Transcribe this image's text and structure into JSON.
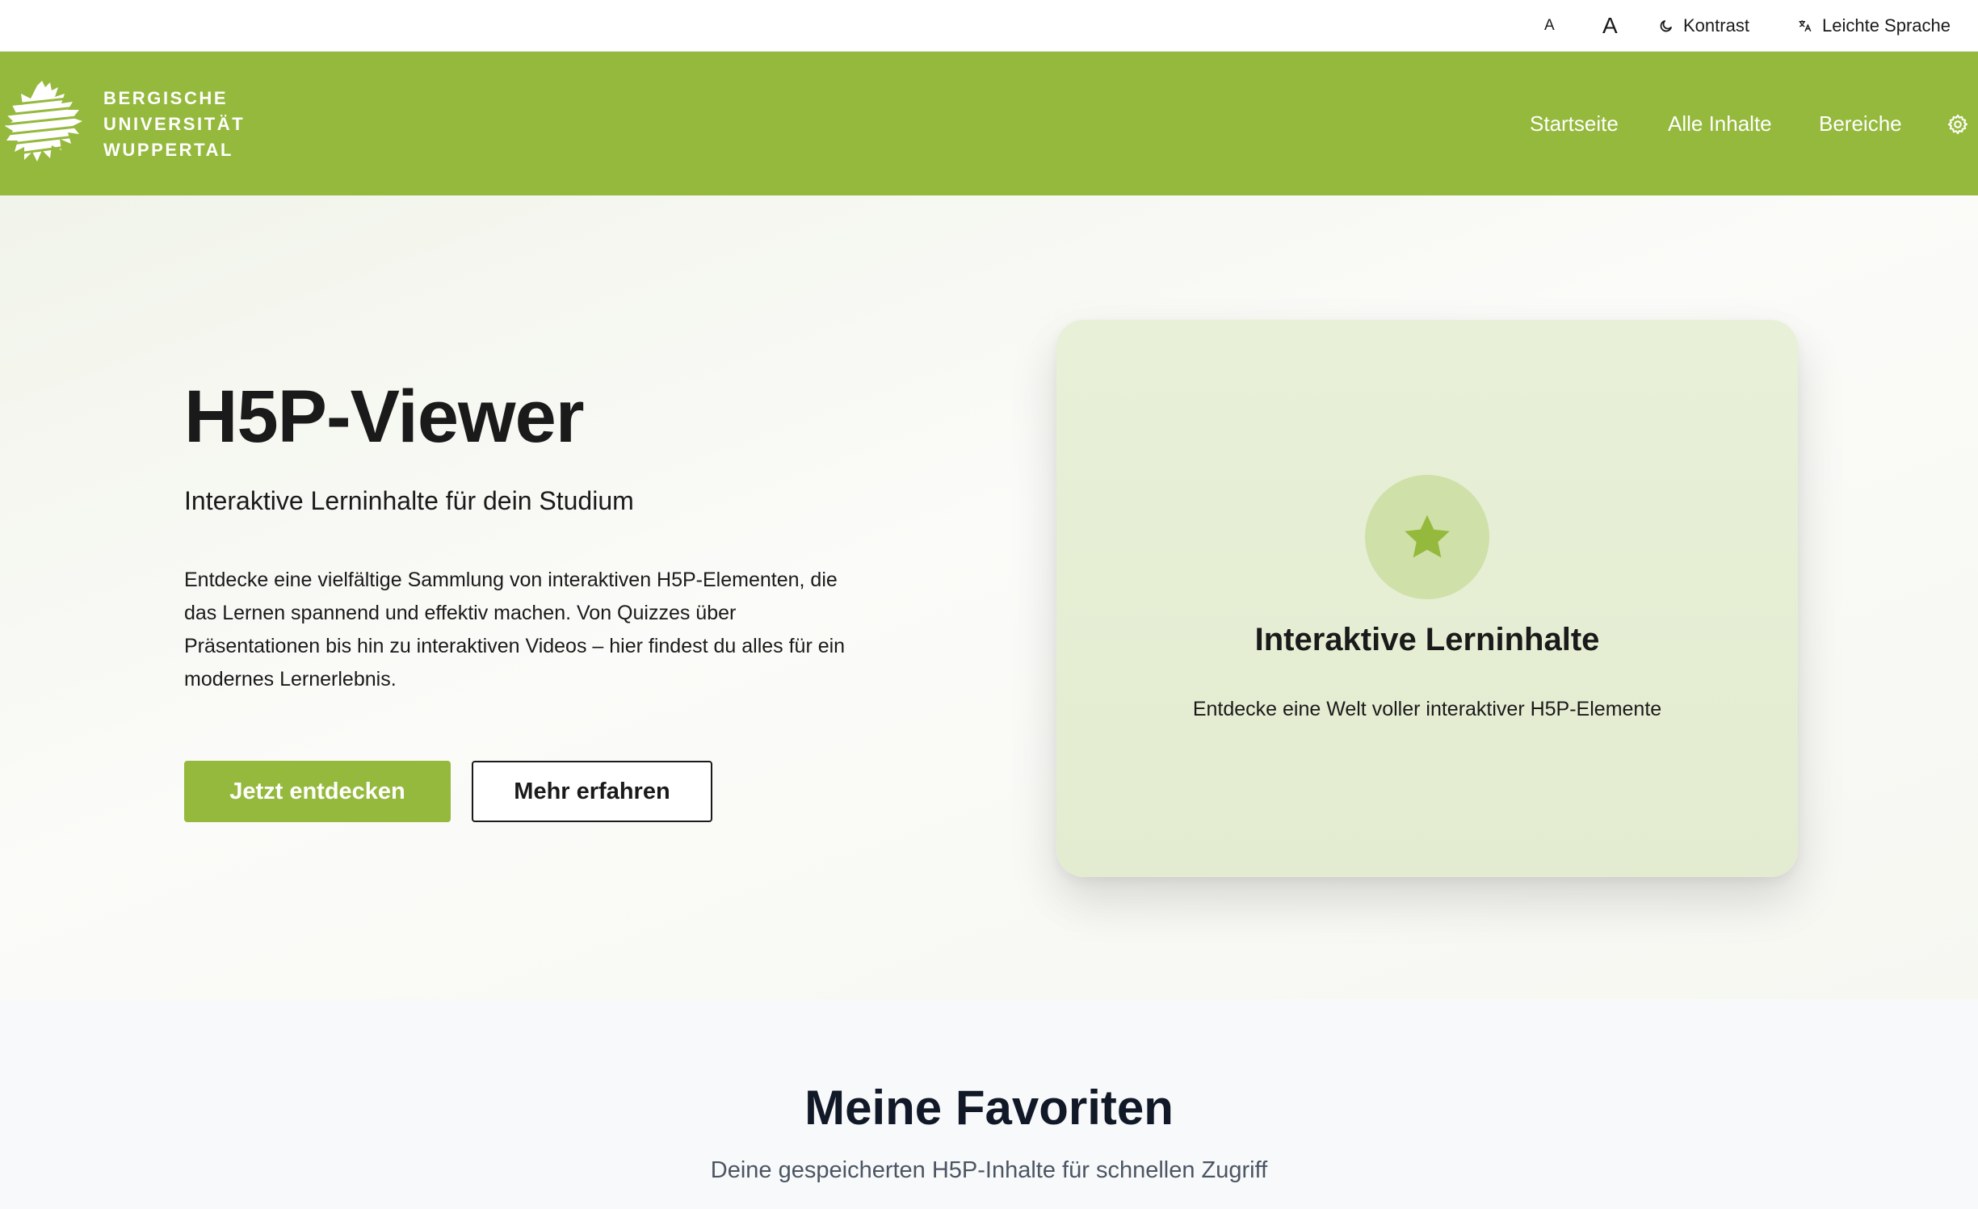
{
  "accessibility": {
    "font_small_label": "A",
    "font_large_label": "A",
    "contrast_label": "Kontrast",
    "easy_language_label": "Leichte Sprache"
  },
  "header": {
    "logo_lines": [
      "BERGISCHE",
      "UNIVERSITÄT",
      "WUPPERTAL"
    ],
    "nav": [
      "Startseite",
      "Alle Inhalte",
      "Bereiche"
    ],
    "brand_color": "#95b93d"
  },
  "hero": {
    "title": "H5P-Viewer",
    "subtitle": "Interaktive Lerninhalte für dein Studium",
    "description": "Entdecke eine vielfältige Sammlung von interaktiven H5P-Elementen, die das Lernen spannend und effektiv machen. Von Quizzes über Präsentationen bis hin zu interaktiven Videos – hier findest du alles für ein modernes Lernerlebnis.",
    "primary_button": "Jetzt entdecken",
    "secondary_button": "Mehr erfahren"
  },
  "feature_card": {
    "icon": "star-icon",
    "title": "Interaktive Lerninhalte",
    "text": "Entdecke eine Welt voller interaktiver H5P-Elemente"
  },
  "favorites": {
    "title": "Meine Favoriten",
    "subtitle": "Deine gespeicherten H5P-Inhalte für schnellen Zugriff"
  }
}
